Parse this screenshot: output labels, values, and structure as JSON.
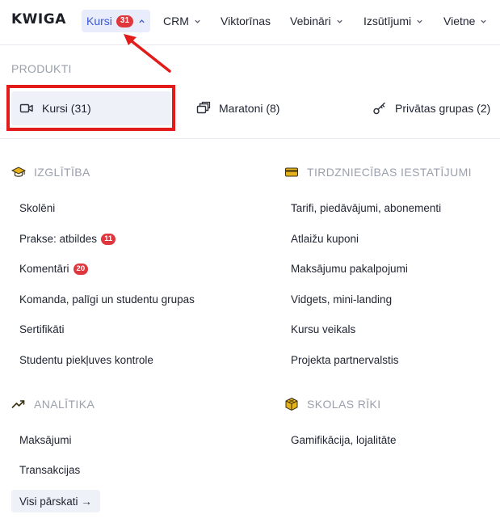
{
  "brand": {
    "logo_text": "KWIGA"
  },
  "nav": {
    "items": [
      {
        "label": "Kursi",
        "badge": "31",
        "chevron": "chevron-up",
        "active": true
      },
      {
        "label": "CRM",
        "chevron": "chevron-down"
      },
      {
        "label": "Viktorīnas"
      },
      {
        "label": "Vebināri",
        "chevron": "chevron-down"
      },
      {
        "label": "Izsūtījumi",
        "chevron": "chevron-down"
      },
      {
        "label": "Vietne",
        "chevron": "chevron-down"
      }
    ]
  },
  "products": {
    "section_label": "PRODUKTI",
    "items": [
      {
        "label": "Kursi (31)",
        "icon": "video-camera-icon",
        "selected": true
      },
      {
        "label": "Maratoni (8)",
        "icon": "stack-icon"
      },
      {
        "label": "Privātas grupas (2)",
        "icon": "key-icon"
      }
    ]
  },
  "education": {
    "heading": "IZGLĪTĪBA",
    "icon": "graduation-cap-icon",
    "links": [
      {
        "label": "Skolēni"
      },
      {
        "label": "Prakse: atbildes",
        "badge": "11"
      },
      {
        "label": "Komentāri",
        "badge": "20"
      },
      {
        "label": "Komanda, palīgi un studentu grupas"
      },
      {
        "label": "Sertifikāti"
      },
      {
        "label": "Studentu piekļuves kontrole"
      }
    ]
  },
  "trade": {
    "heading": "TIRDZNIECĪBAS IESTATĪJUMI",
    "icon": "credit-card-icon",
    "links": [
      {
        "label": "Tarifi, piedāvājumi, abonementi"
      },
      {
        "label": "Atlaižu kuponi"
      },
      {
        "label": "Maksājumu pakalpojumi"
      },
      {
        "label": "Vidgets, mini-landing"
      },
      {
        "label": "Kursu veikals"
      },
      {
        "label": "Projekta partnervalstis"
      }
    ]
  },
  "analytics": {
    "heading": "ANALĪTIKA",
    "icon": "trending-up-icon",
    "links": [
      {
        "label": "Maksājumi"
      },
      {
        "label": "Transakcijas"
      }
    ],
    "all_reports_label": "Visi pārskati →"
  },
  "tools": {
    "heading": "SKOLAS RĪKI",
    "icon": "cube-icon",
    "links": [
      {
        "label": "Gamifikācija, lojalitāte"
      }
    ]
  },
  "colors": {
    "accent": "#3a57d6",
    "badge": "#e0373e",
    "annotation": "#e21b1b",
    "icon_gold": "#e5b21a"
  }
}
